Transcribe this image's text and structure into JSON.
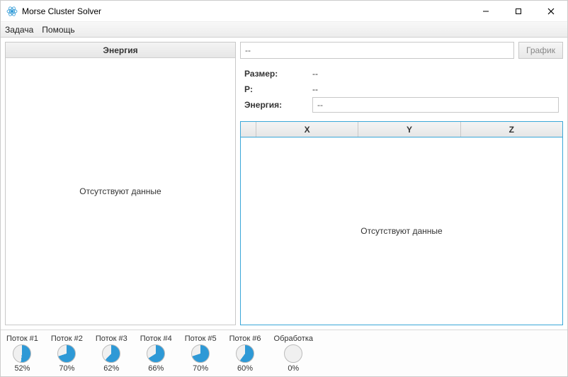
{
  "window": {
    "title": "Morse Cluster Solver"
  },
  "menu": {
    "task": "Задача",
    "help": "Помощь"
  },
  "left": {
    "header": "Энергия",
    "empty": "Отсутствуют данные"
  },
  "right": {
    "top_input": "--",
    "graph_btn": "График",
    "size_label": "Размер:",
    "size_value": "--",
    "p_label": "P:",
    "p_value": "--",
    "energy_label": "Энергия:",
    "energy_value": "--",
    "grid": {
      "col_x": "X",
      "col_y": "Y",
      "col_z": "Z",
      "empty": "Отсутствуют данные"
    }
  },
  "threads": [
    {
      "label": "Поток #1",
      "percent": 52,
      "text": "52%"
    },
    {
      "label": "Поток #2",
      "percent": 70,
      "text": "70%"
    },
    {
      "label": "Поток #3",
      "percent": 62,
      "text": "62%"
    },
    {
      "label": "Поток #4",
      "percent": 66,
      "text": "66%"
    },
    {
      "label": "Поток #5",
      "percent": 70,
      "text": "70%"
    },
    {
      "label": "Поток #6",
      "percent": 60,
      "text": "60%"
    },
    {
      "label": "Обработка",
      "percent": 0,
      "text": "0%"
    }
  ],
  "colors": {
    "accent": "#2e99d6",
    "pie_track": "#f0f0f0"
  }
}
